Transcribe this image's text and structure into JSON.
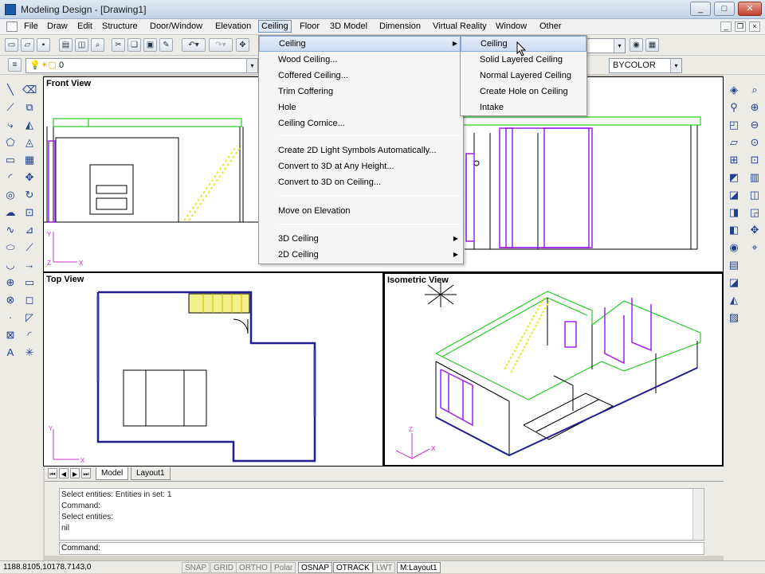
{
  "window": {
    "title": "Modeling Design - [Drawing1]",
    "min": "_",
    "max": "□",
    "close": "✕"
  },
  "menubar": [
    "File",
    "Draw",
    "Edit",
    "Structure",
    "Door/Window",
    "Elevation",
    "Ceiling",
    "Floor",
    "3D Model",
    "Dimension",
    "Virtual Reality",
    "Window",
    "Other"
  ],
  "menubar_open": "Ceiling",
  "toolbar": {
    "layer_combo": "0",
    "color_combo": "BYCOLOR",
    "undo_icon": "undo-icon",
    "redo_icon": "redo-icon"
  },
  "viewports": {
    "front": "Front View",
    "top": "Top View",
    "iso": "Isometric View"
  },
  "ceiling_menu": {
    "items": [
      "Ceiling",
      "Wood Ceiling...",
      "Coffered Ceiling...",
      "Trim Coffering",
      "Hole",
      "Ceiling Cornice...",
      "Create 2D Light Symbols Automatically...",
      "Convert to 3D at Any Height...",
      "Convert to 3D on Ceiling...",
      "Move on Elevation",
      "3D Ceiling",
      "2D Ceiling"
    ]
  },
  "ceiling_submenu": {
    "items": [
      "Ceiling",
      "Solid Layered Ceiling",
      "Normal Layered Ceiling",
      "Create Hole on Ceiling",
      "Intake"
    ]
  },
  "layout_tabs": [
    "Model",
    "Layout1"
  ],
  "command": {
    "history": [
      "Select entities: Entities in set: 1",
      "Command:",
      "Select entities:",
      "nil"
    ],
    "prompt": "Command:"
  },
  "status": {
    "coords": "1188.8105,10178.7143,0",
    "toggles": [
      "SNAP",
      "GRID",
      "ORTHO",
      "Polar",
      "OSNAP",
      "OTRACK",
      "LWT",
      "M:Layout1"
    ],
    "active": [
      "OSNAP",
      "OTRACK",
      "M:Layout1"
    ]
  },
  "colors": {
    "wall_blue": "#1f1f8f",
    "ceiling_green": "#22cc22",
    "wall_purple": "#a020f0",
    "stair_yellow": "#e8e830"
  }
}
